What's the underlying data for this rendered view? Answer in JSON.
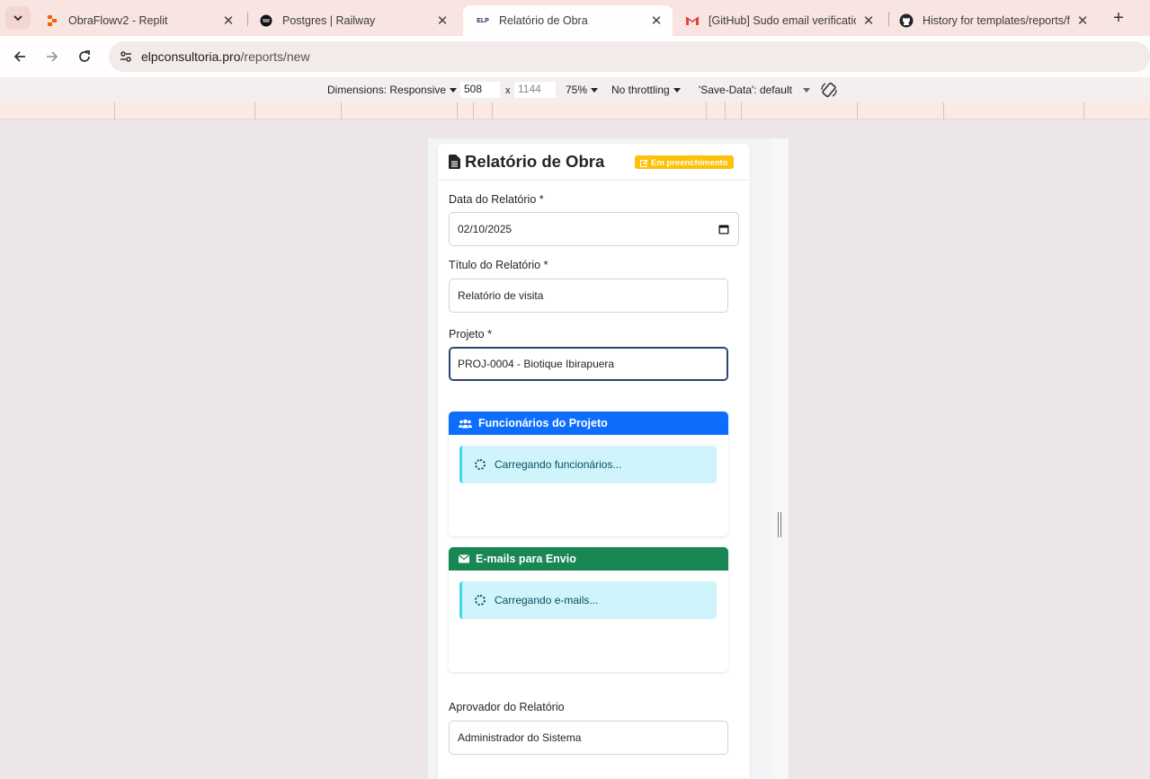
{
  "browser": {
    "tabs": [
      {
        "title": "ObraFlowv2 - Replit",
        "icon": "replit-icon"
      },
      {
        "title": "Postgres | Railway",
        "icon": "railway-icon"
      },
      {
        "title": "Relatório de Obra",
        "icon": "elp-icon",
        "favicon_text": "ELP"
      },
      {
        "title": "[GitHub] Sudo email verification",
        "icon": "gmail-icon"
      },
      {
        "title": "History for templates/reports/fo",
        "icon": "github-icon"
      }
    ],
    "url_host": "elpconsultoria.pro",
    "url_path": "/reports/new"
  },
  "devtools": {
    "dimensions_label": "Dimensions: Responsive",
    "width": "508",
    "times": "x",
    "height": "1144",
    "zoom": "75%",
    "throttling": "No throttling",
    "save_data": "'Save-Data': default"
  },
  "page": {
    "title": "Relatório de Obra",
    "status_badge": "Em preenchimento",
    "fields": {
      "date": {
        "label": "Data do Relatório *",
        "value": "02/10/2025"
      },
      "title": {
        "label": "Título do Relatório *",
        "value": "Relatório de visita"
      },
      "project": {
        "label": "Projeto *",
        "value": "PROJ-0004 - Biotique Ibirapuera"
      },
      "approver": {
        "label": "Aprovador do Relatório",
        "value": "Administrador do Sistema"
      }
    },
    "employees_panel": {
      "title": "Funcionários do Projeto",
      "loading": "Carregando funcionários...",
      "color": "#0d6efd"
    },
    "emails_panel": {
      "title": "E-mails para Envio",
      "loading": "Carregando e-mails...",
      "color": "#198754"
    }
  }
}
